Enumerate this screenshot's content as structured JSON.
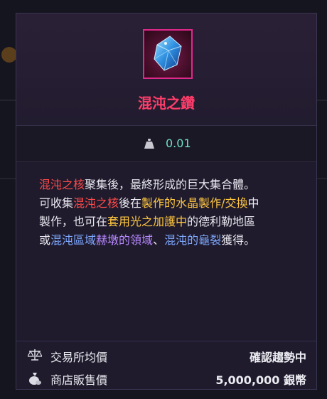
{
  "item": {
    "name": "混沌之鑽",
    "weight": "0.01",
    "description": [
      [
        {
          "t": "混沌之核",
          "c": "hl-red"
        },
        {
          "t": "聚集後，最終形成的巨大集合體。",
          "c": ""
        }
      ],
      [
        {
          "t": "可收集",
          "c": ""
        },
        {
          "t": "混沌之核",
          "c": "hl-red"
        },
        {
          "t": "後在",
          "c": ""
        },
        {
          "t": "製作的",
          "c": "hl-yellow"
        },
        {
          "t": "水晶製作/交換",
          "c": "hl-yellow"
        },
        {
          "t": "中",
          "c": ""
        }
      ],
      [
        {
          "t": "製作，也可在",
          "c": ""
        },
        {
          "t": "套用光之加護中",
          "c": "hl-yellow"
        },
        {
          "t": "的德利勒地區",
          "c": ""
        }
      ],
      [
        {
          "t": "或",
          "c": ""
        },
        {
          "t": "混沌區域",
          "c": "hl-blue"
        },
        {
          "t": "赫墩的領域",
          "c": "hl-purple"
        },
        {
          "t": "、",
          "c": ""
        },
        {
          "t": "混沌的龜裂",
          "c": "hl-blue"
        },
        {
          "t": "獲得。",
          "c": ""
        }
      ]
    ]
  },
  "footer": {
    "trade_label": "交易所均價",
    "trade_value": "確認趨勢中",
    "shop_label": "商店販售價",
    "shop_value": "5,000,000 銀幣"
  },
  "colors": {
    "name": "#ff3d6b",
    "weight": "#6ee0c4",
    "frame": "#e0288a"
  },
  "icons": {
    "item": "chaos-gem-icon",
    "weight": "weight-icon",
    "trade": "balance-scale-icon",
    "shop": "money-bag-icon"
  }
}
